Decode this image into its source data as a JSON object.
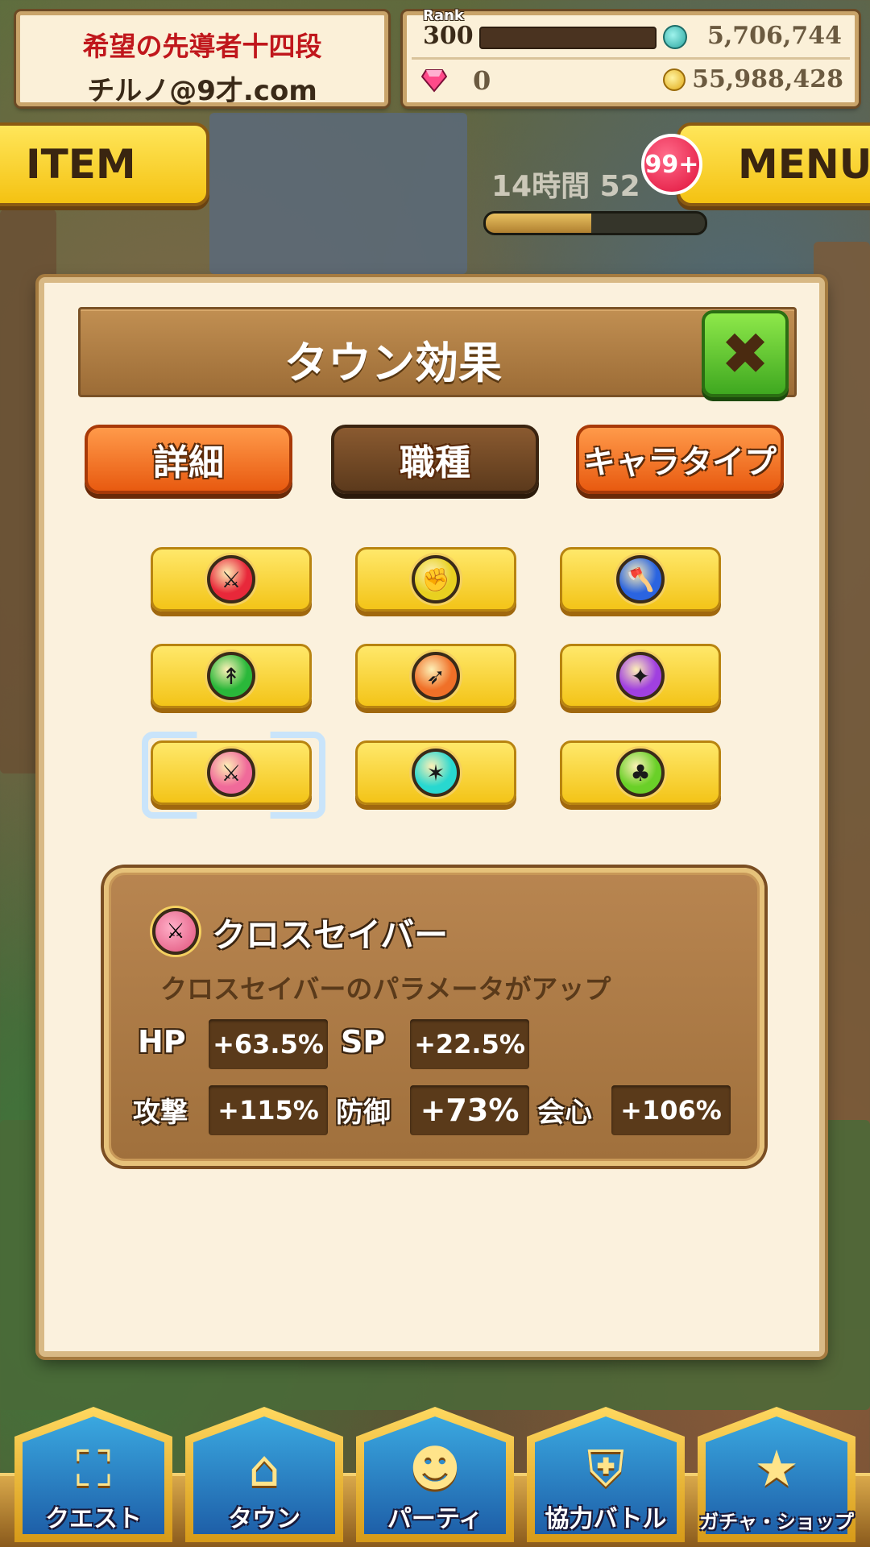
{
  "player": {
    "title": "希望の先導者十四段",
    "name": "チルノ@9才.com"
  },
  "stats": {
    "rank_caption": "Rank",
    "rank": "300",
    "stamina": "5,706,744",
    "gems": "0",
    "coins": "55,988,428"
  },
  "hud": {
    "item_label": "ITEM",
    "menu_label": "MENU",
    "menu_badge": "99+",
    "timer_text": "14時間 52",
    "timer_progress": 0.48
  },
  "modal": {
    "title": "タウン効果",
    "close_glyph": "✖",
    "tabs": [
      {
        "label": "詳細",
        "active": false
      },
      {
        "label": "職種",
        "active": true
      },
      {
        "label": "キャラタイプ",
        "active": false
      }
    ],
    "jobs": [
      {
        "icon": "sword-icon",
        "glyph": "⚔",
        "color": "#e8283a"
      },
      {
        "icon": "fist-icon",
        "glyph": "✊",
        "color": "#e8d020"
      },
      {
        "icon": "axe-icon",
        "glyph": "🪓",
        "color": "#2a64e0"
      },
      {
        "icon": "spear-icon",
        "glyph": "↟",
        "color": "#2ab83a"
      },
      {
        "icon": "bow-icon",
        "glyph": "➶",
        "color": "#f07028"
      },
      {
        "icon": "staff-icon",
        "glyph": "✦",
        "color": "#a040e0"
      },
      {
        "icon": "cross-saber-icon",
        "glyph": "⚔",
        "color": "#f06a9a",
        "selected": true
      },
      {
        "icon": "dragon-icon",
        "glyph": "✶",
        "color": "#28d8d0"
      },
      {
        "icon": "claw-icon",
        "glyph": "♣",
        "color": "#6ad028"
      }
    ],
    "info": {
      "name": "クロスセイバー",
      "description": "クロスセイバーのパラメータがアップ",
      "stats": [
        {
          "label": "HP",
          "value": "+63.5%"
        },
        {
          "label": "SP",
          "value": "+22.5%"
        },
        {
          "label": "攻撃",
          "value": "+115%"
        },
        {
          "label": "防御",
          "value": "+73%"
        },
        {
          "label": "会心",
          "value": "+106%"
        }
      ]
    }
  },
  "nav": [
    {
      "label": "クエスト",
      "icon": "quest-map-icon",
      "glyph": "⛶"
    },
    {
      "label": "タウン",
      "icon": "town-icon",
      "glyph": "⌂"
    },
    {
      "label": "パーティ",
      "icon": "party-icon",
      "glyph": "☻"
    },
    {
      "label": "協力バトル",
      "icon": "shield-icon",
      "glyph": "⛨"
    },
    {
      "label": "ガチャ・ショップ",
      "icon": "star-icon",
      "glyph": "★"
    }
  ]
}
